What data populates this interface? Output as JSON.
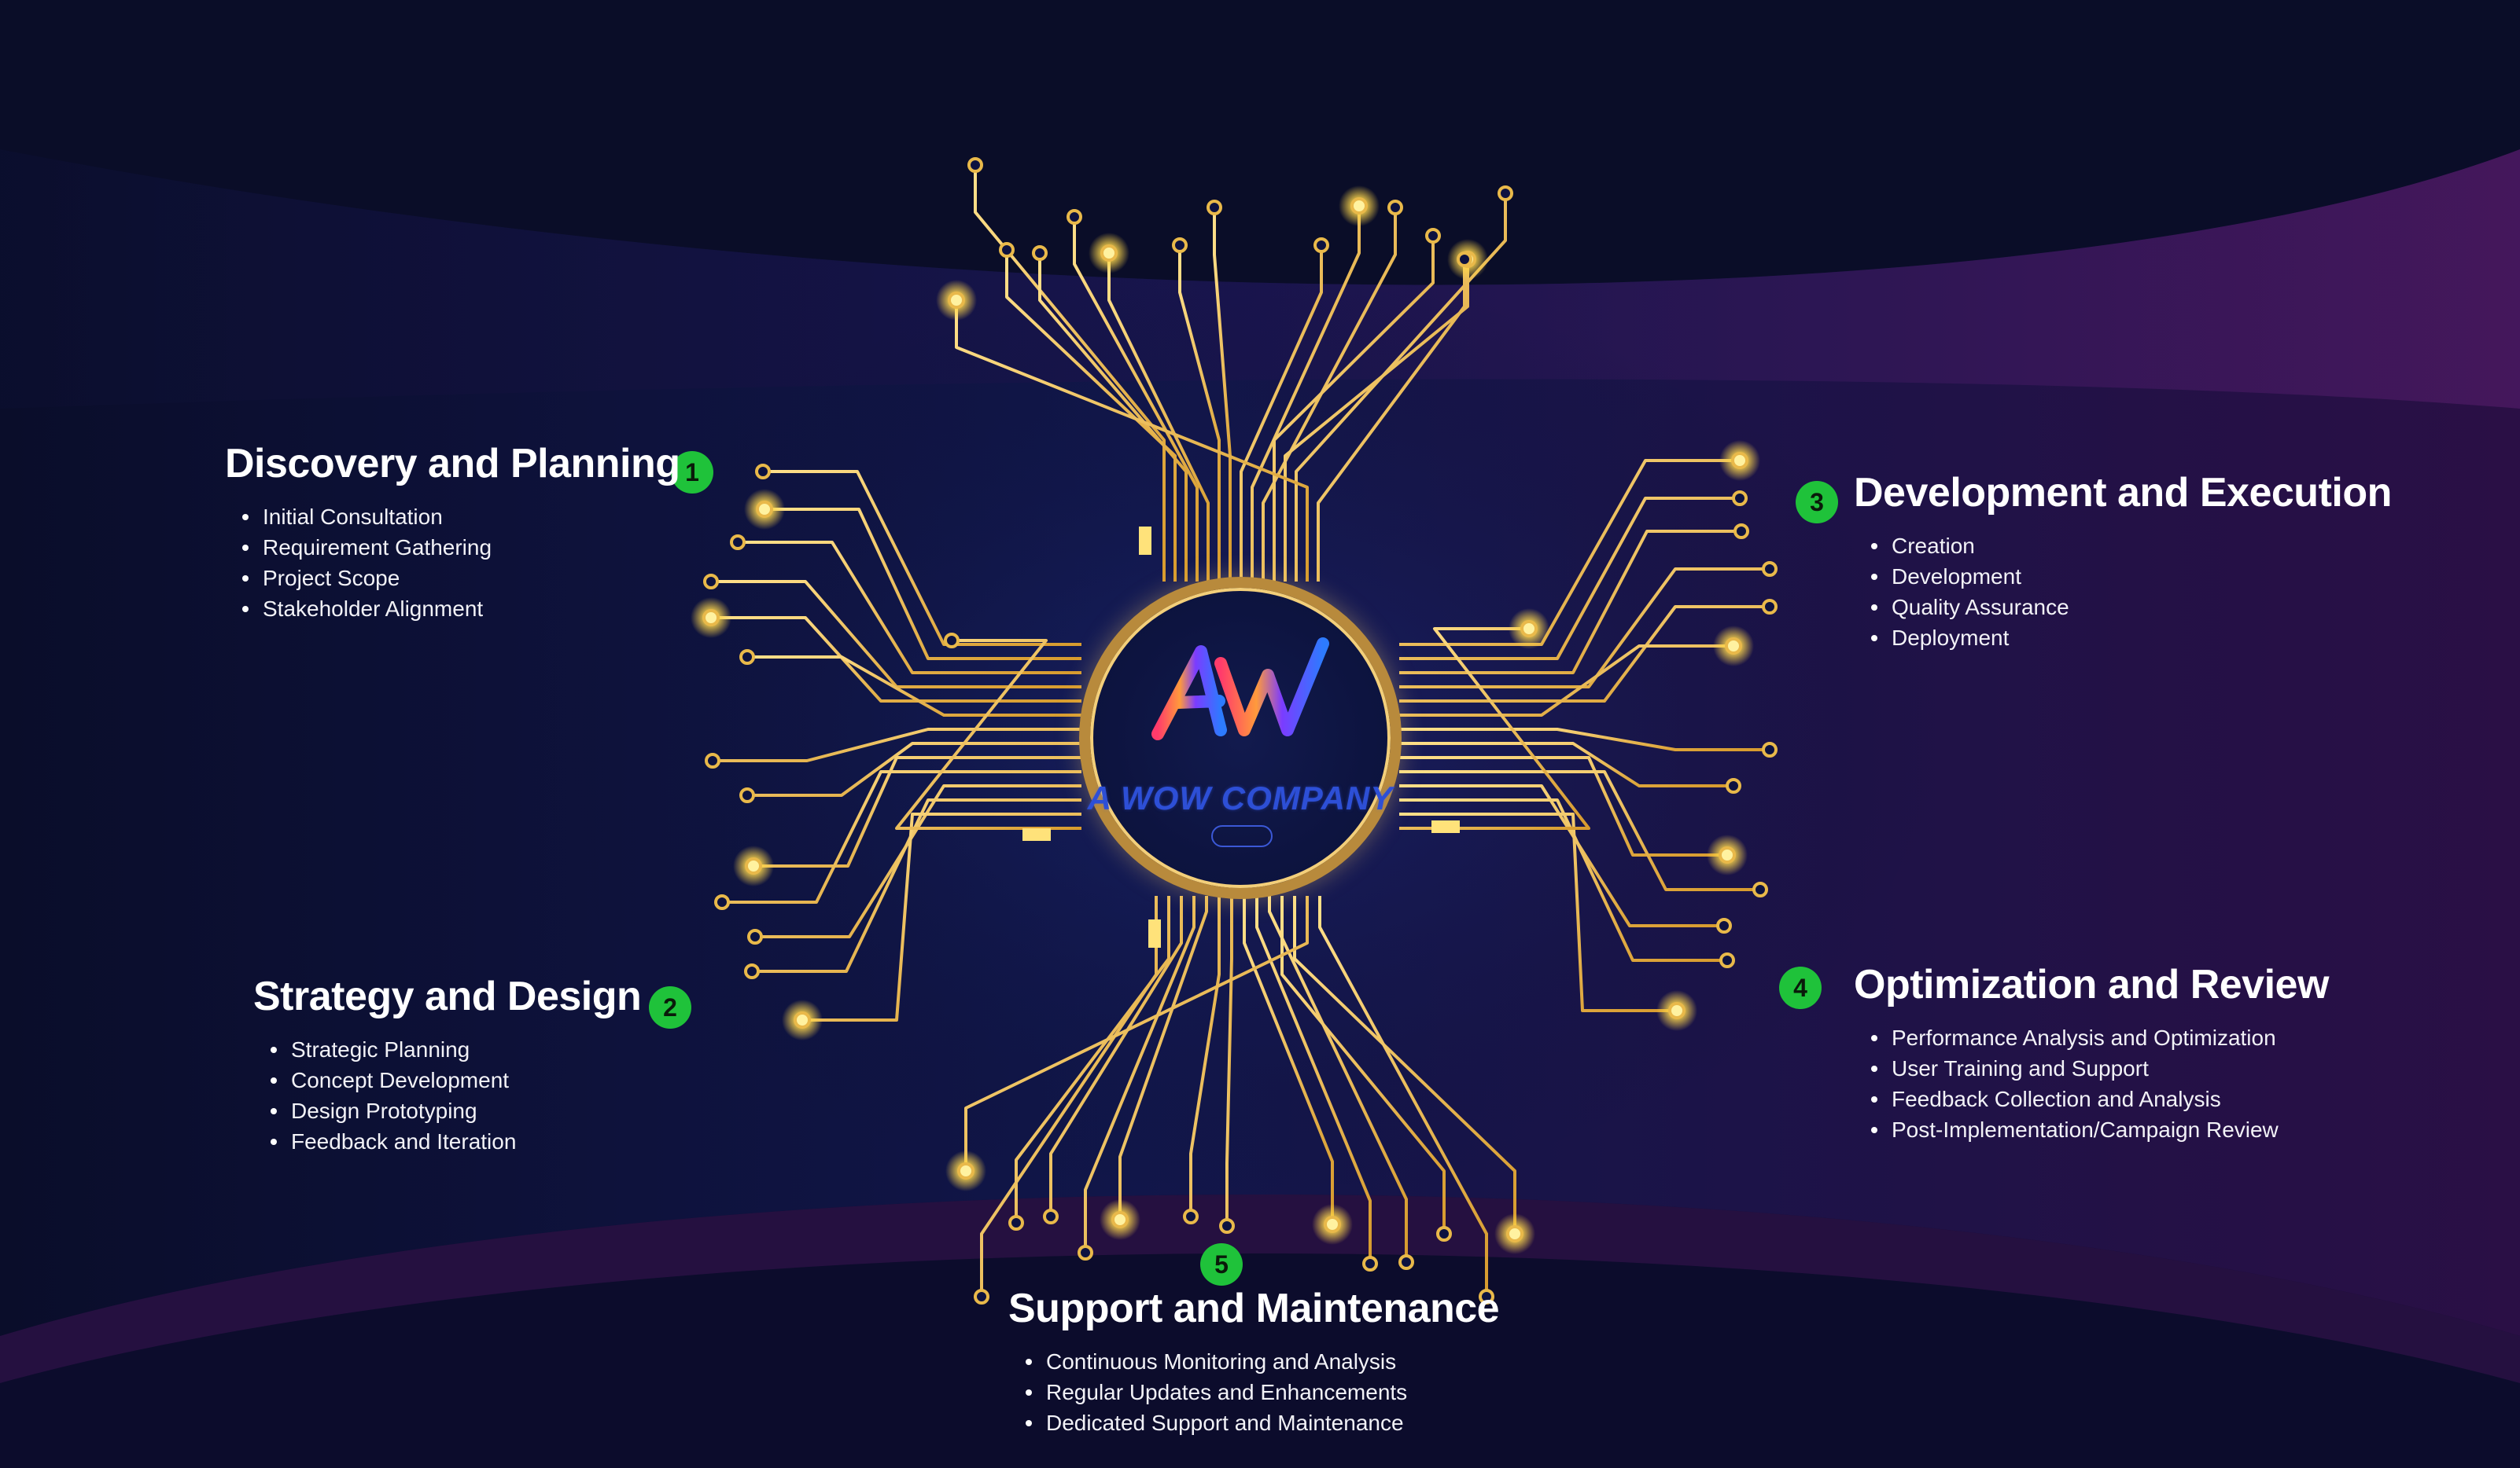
{
  "center": {
    "company_name": "A WOW COMPANY"
  },
  "phases": [
    {
      "number": "1",
      "title": "Discovery and Planning",
      "items": [
        "Initial Consultation",
        "Requirement Gathering",
        "Project Scope",
        "Stakeholder Alignment"
      ]
    },
    {
      "number": "2",
      "title": "Strategy and Design",
      "items": [
        "Strategic Planning",
        "Concept Development",
        "Design Prototyping",
        "Feedback and Iteration"
      ]
    },
    {
      "number": "3",
      "title": "Development and Execution",
      "items": [
        "Creation",
        "Development",
        "Quality Assurance",
        "Deployment"
      ]
    },
    {
      "number": "4",
      "title": "Optimization and Review",
      "items": [
        "Performance Analysis and Optimization",
        "User Training and Support",
        "Feedback Collection and Analysis",
        "Post-Implementation/Campaign Review"
      ]
    },
    {
      "number": "5",
      "title": "Support and Maintenance",
      "items": [
        "Continuous Monitoring and Analysis",
        "Regular Updates and Enhancements",
        "Dedicated Support and Maintenance"
      ]
    }
  ],
  "colors": {
    "background": "#0b0f2e",
    "accent_purple": "#3a1452",
    "circuit_gold": "#e9b94a",
    "badge_green": "#1fc23a",
    "logo_blue": "#2d4fd6"
  }
}
